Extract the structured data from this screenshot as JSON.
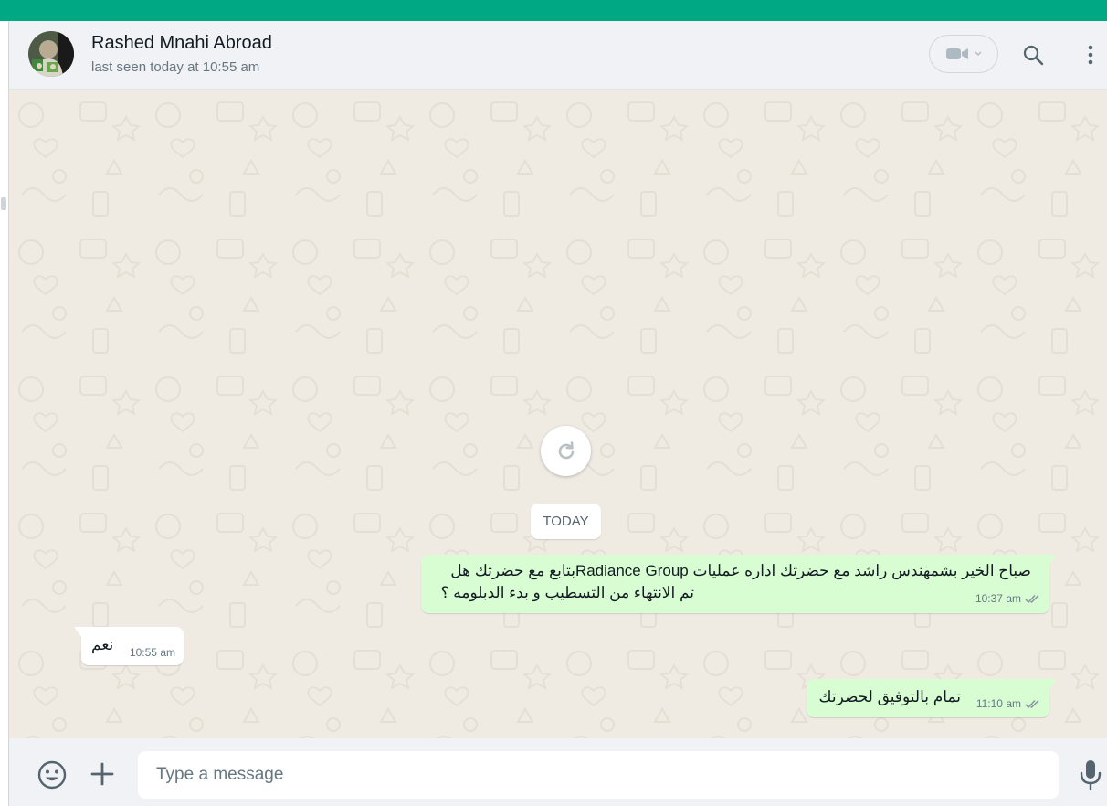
{
  "contact": {
    "name": "Rashed Mnahi Abroad",
    "status": "last seen today at 10:55 am"
  },
  "date_chip": "TODAY",
  "messages": [
    {
      "direction": "out",
      "line1": "صباح الخير بشمهندس راشد مع  حضرتك اداره عمليات Radiance Groupبتابع مع حضرتك هل",
      "line2": "تم الانتهاء من التسطيب و بدء الدبلومه ؟",
      "time": "10:37 am",
      "read": true
    },
    {
      "direction": "in",
      "text": "نعم",
      "time": "10:55 am"
    },
    {
      "direction": "out",
      "text": "تمام بالتوفيق لحضرتك",
      "time": "11:10 am",
      "read": true
    }
  ],
  "composer": {
    "placeholder": "Type a message"
  },
  "icons": {
    "video": "video-camera-icon",
    "search": "search-icon",
    "menu": "kebab-menu-icon",
    "emoji": "emoji-icon",
    "attach": "plus-icon",
    "mic": "microphone-icon",
    "refresh": "refresh-icon",
    "ticks": "double-check-icon"
  },
  "colors": {
    "brand": "#00a884",
    "outgoing_bubble": "#d9fdd3",
    "incoming_bubble": "#ffffff",
    "chat_background": "#efeae2",
    "read_ticks": "#8696a0"
  }
}
